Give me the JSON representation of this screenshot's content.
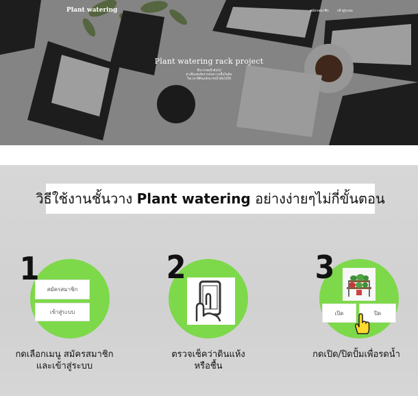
{
  "hero": {
    "brand": "Plant watering",
    "nav": [
      "สมัครสมาชิก",
      "เข้าสู่ระบบ"
    ],
    "title": "Plant watering rack project",
    "lines": [
      "ชั้นวางรดน้ำต้นไม้",
      "ตัวเซ็นเซอร์ตรวจจับความชื้นในดิน",
      "ในเวลาที่ดินแห้งจะรดน้ำต้นไม้ให้"
    ]
  },
  "howto": {
    "headline_pre": "วิธีใช้งานชั้นวาง",
    "headline_brand": "Plant watering",
    "headline_post": "อย่างง่ายๆไม่กี่ขั้นตอน",
    "steps": [
      {
        "number": "1",
        "buttons": [
          "สมัครสมาชิก",
          "เข้าสู่ระบบ"
        ],
        "caption_line1": "กดเลือกเมนู สมัครสมาชิก",
        "caption_line2": "และเข้าสู่ระบบ"
      },
      {
        "number": "2",
        "caption_line1": "ตรวจเช็คว่าดินแห้ง",
        "caption_line2": "หรือชื้น"
      },
      {
        "number": "3",
        "buttons": [
          "เปิด",
          "ปิด"
        ],
        "caption_line1": "กดเปิด/ปิดปั้มเพื่อรดน้ำ"
      }
    ]
  },
  "colors": {
    "accent_green": "#7dd94a",
    "section_bg": "#d4d4d4"
  },
  "icons": [
    "phone-touch-icon",
    "plant-rack-icon",
    "hand-pointer-icon"
  ]
}
